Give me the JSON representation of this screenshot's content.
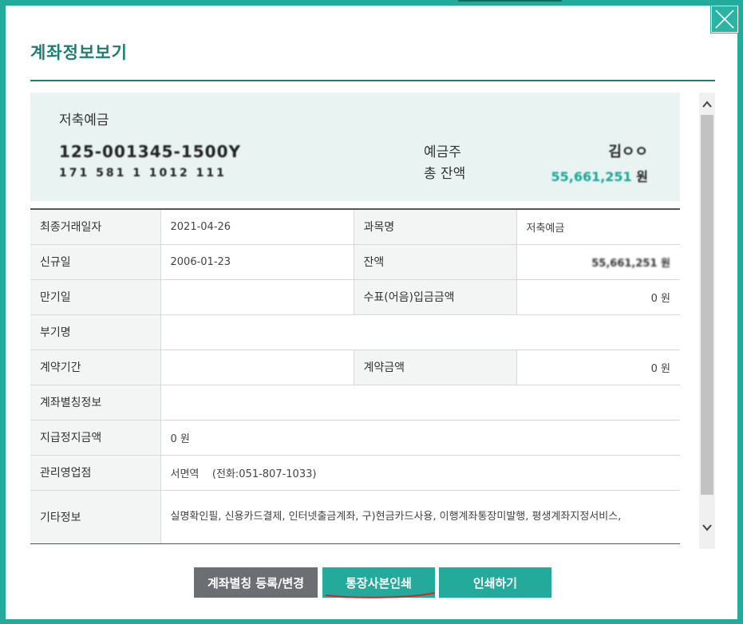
{
  "dialog": {
    "title": "계좌정보보기",
    "close_icon": "close-icon"
  },
  "summary": {
    "account_type": "저축예금",
    "account_number": "125-001345-1500Y",
    "account_subtext": "171 581 1 1012 111",
    "holder_label": "예금주",
    "holder_value": "김ㅇㅇ",
    "balance_label": "총 잔액",
    "balance_value": "55,661,251",
    "balance_unit": "원"
  },
  "details": {
    "last_txn_label": "최종거래일자",
    "last_txn_value": "2021-04-26",
    "subject_label": "과목명",
    "subject_value": "저축예금",
    "open_label": "신규일",
    "open_value": "2006-01-23",
    "balance_label": "잔액",
    "balance_value": "55,661,251 원",
    "maturity_label": "만기일",
    "maturity_value": "",
    "check_deposit_label": "수표(어음)입금금액",
    "check_deposit_value": "0 원",
    "book_name_label": "부기명",
    "book_name_value": "",
    "contract_period_label": "계약기간",
    "contract_period_value": "",
    "contract_amount_label": "계약금액",
    "contract_amount_value": "0 원",
    "alias_label": "계좌별칭정보",
    "alias_value": "",
    "suspend_label": "지급정지금액",
    "suspend_value": "0 원",
    "branch_label": "관리영업점",
    "branch_value": "서면역    (전화:051-807-1033)",
    "etc_label": "기타정보",
    "etc_value": "실명확인필, 신용카드결제, 인터넷출금계좌, 구)현금카드사용, 이행계좌통장미발행, 평생계좌지정서비스,"
  },
  "buttons": {
    "alias_register": "계좌별칭 등록/변경",
    "passbook_print": "통장사본인쇄",
    "print": "인쇄하기"
  },
  "colors": {
    "accent": "#23aa9a",
    "title": "#1d7f74",
    "summary_bg": "#e8f3f2",
    "gray_button": "#6b6e72",
    "annotation": "#e02020"
  }
}
